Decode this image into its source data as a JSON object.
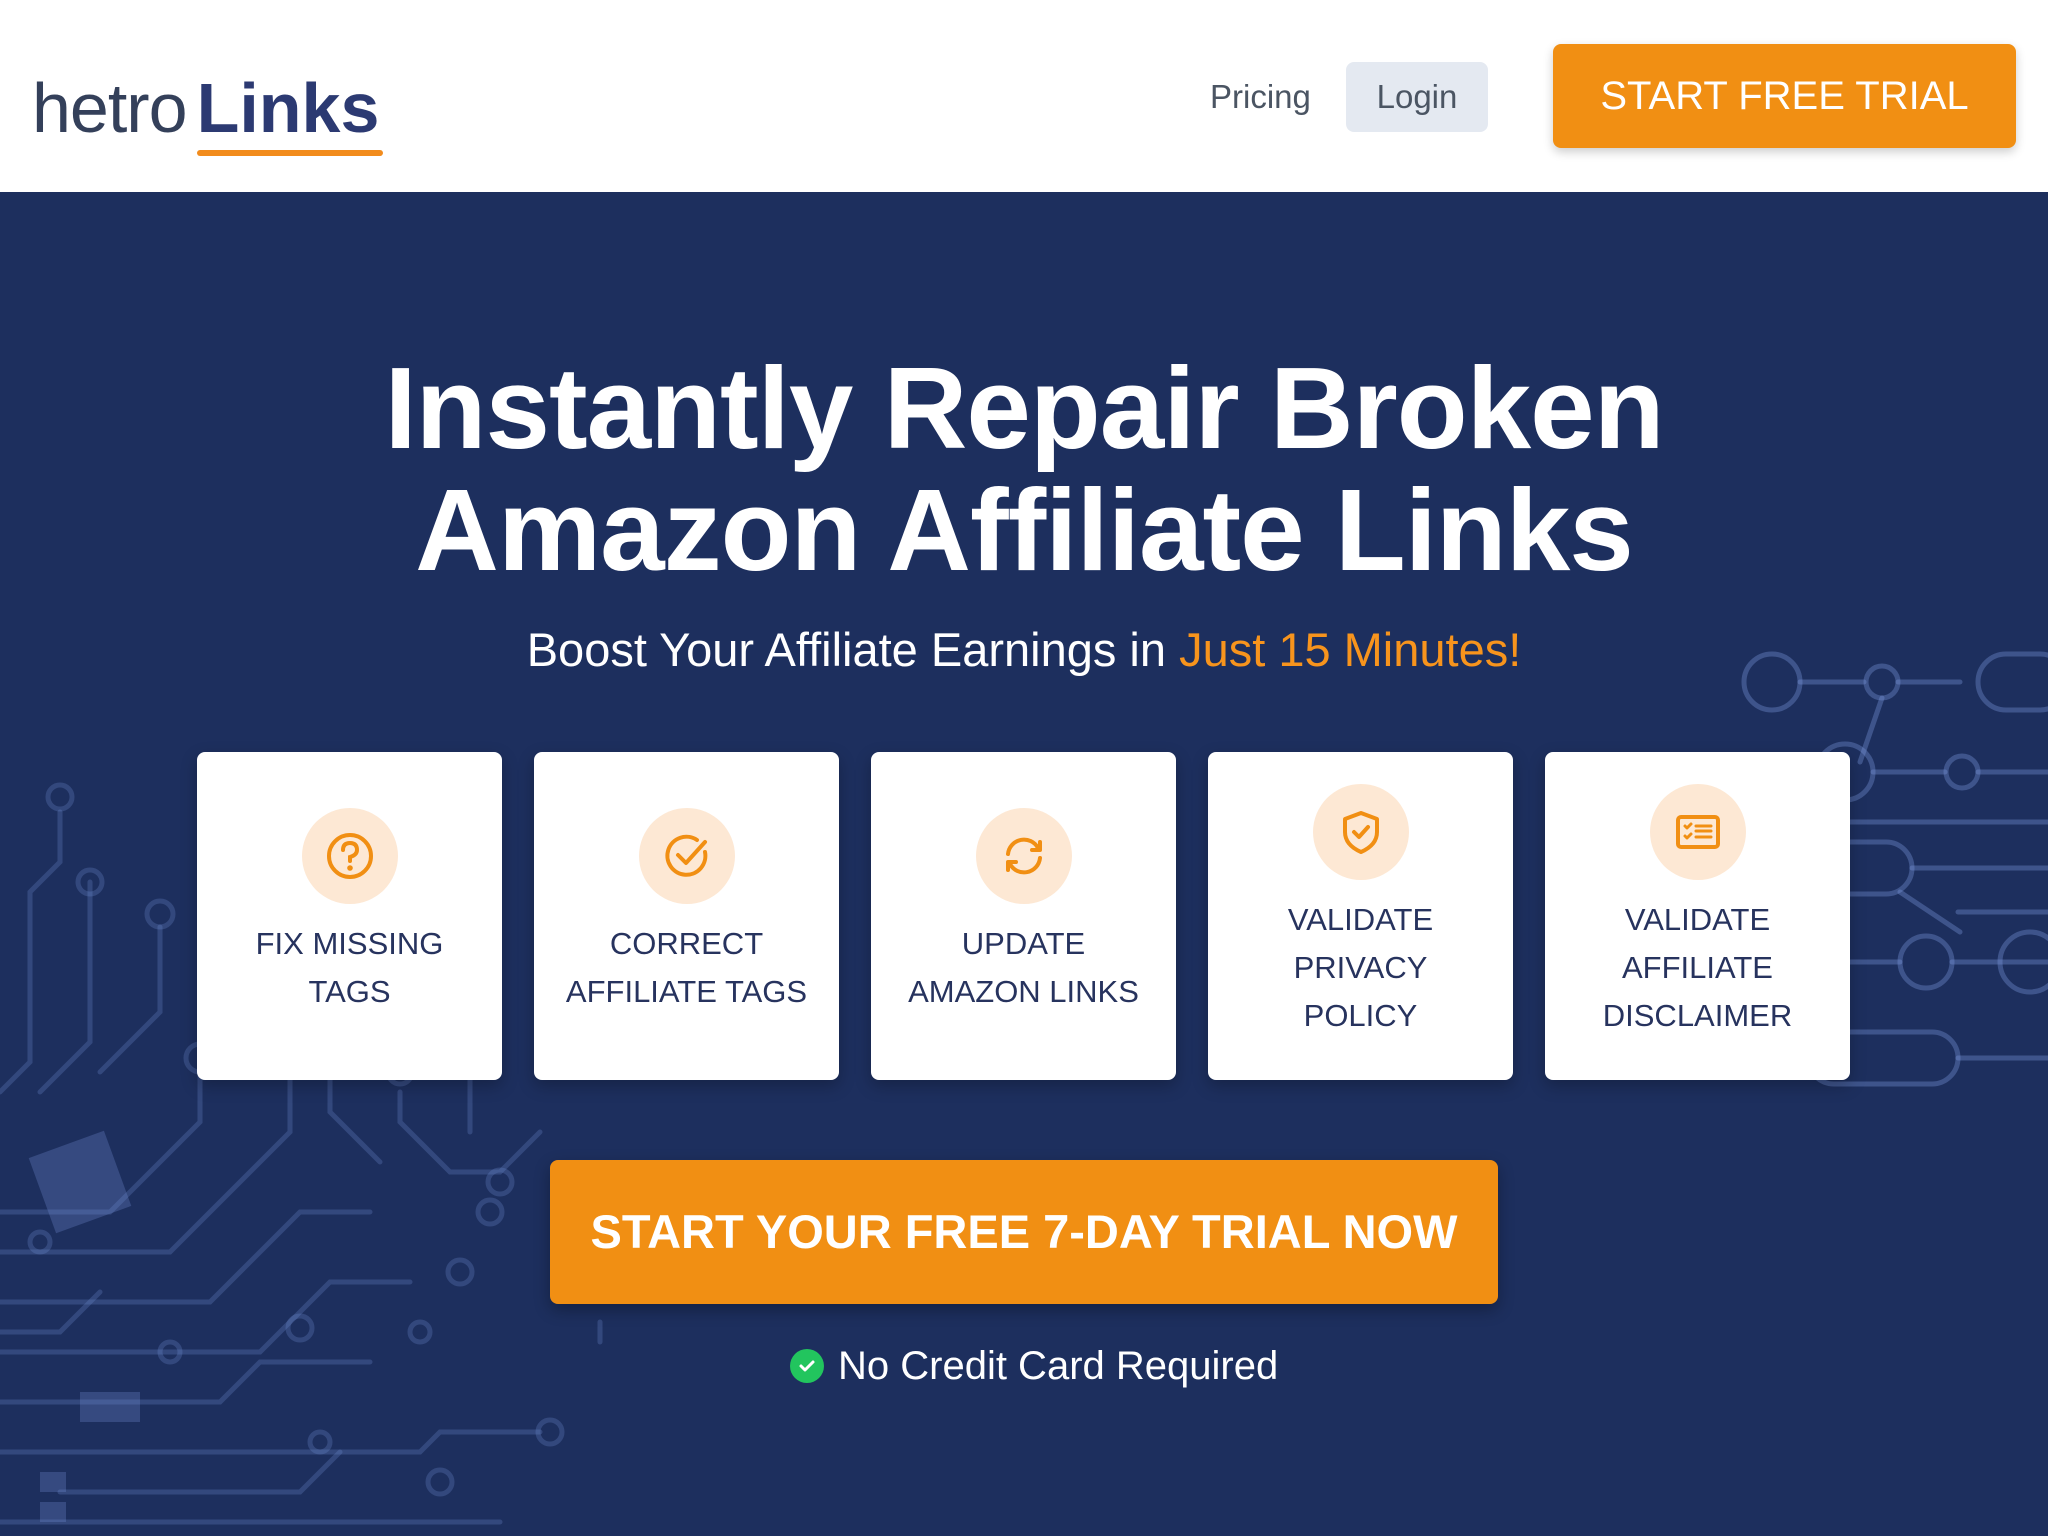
{
  "brand": {
    "logo_part1": "hetro",
    "logo_part2": "Links",
    "accent_color": "#f18f13",
    "navy_color": "#1d2f5e"
  },
  "nav": {
    "pricing": "Pricing",
    "login": "Login",
    "trial": "START FREE TRIAL"
  },
  "hero": {
    "title_line1": "Instantly Repair Broken",
    "title_line2": "Amazon Affiliate Links",
    "subtitle_prefix": "Boost Your Affiliate Earnings in ",
    "subtitle_accent": "Just 15 Minutes!"
  },
  "features": [
    {
      "icon": "question-circle-icon",
      "line1": "FIX MISSING",
      "line2": "TAGS",
      "line3": ""
    },
    {
      "icon": "check-circle-icon",
      "line1": "CORRECT",
      "line2": "AFFILIATE TAGS",
      "line3": ""
    },
    {
      "icon": "refresh-icon",
      "line1": "UPDATE",
      "line2": "AMAZON LINKS",
      "line3": ""
    },
    {
      "icon": "shield-check-icon",
      "line1": "VALIDATE",
      "line2": "PRIVACY",
      "line3": "POLICY"
    },
    {
      "icon": "checklist-icon",
      "line1": "VALIDATE",
      "line2": "AFFILIATE",
      "line3": "DISCLAIMER"
    }
  ],
  "cta": {
    "label": "START YOUR FREE 7-DAY TRIAL NOW"
  },
  "note": {
    "icon": "check-icon",
    "text": "No Credit Card Required"
  }
}
